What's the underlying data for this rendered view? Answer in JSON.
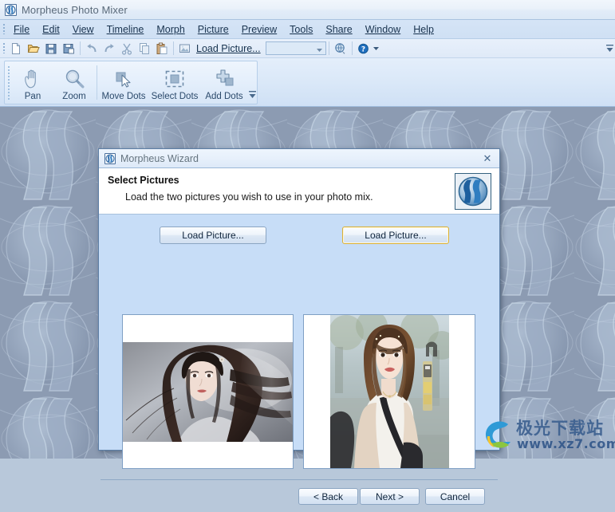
{
  "window": {
    "title": "Morpheus Photo Mixer",
    "icon": "app-icon"
  },
  "menubar": {
    "items": [
      {
        "label": "File"
      },
      {
        "label": "Edit"
      },
      {
        "label": "View"
      },
      {
        "label": "Timeline"
      },
      {
        "label": "Morph"
      },
      {
        "label": "Picture"
      },
      {
        "label": "Preview"
      },
      {
        "label": "Tools"
      },
      {
        "label": "Share"
      },
      {
        "label": "Window"
      },
      {
        "label": "Help"
      }
    ]
  },
  "toolbar_small": {
    "buttons": [
      {
        "name": "new-icon"
      },
      {
        "name": "open-icon"
      },
      {
        "name": "save-icon"
      },
      {
        "name": "save-as-icon"
      },
      {
        "name": "undo-icon"
      },
      {
        "name": "redo-icon"
      },
      {
        "name": "cut-icon"
      },
      {
        "name": "copy-icon"
      },
      {
        "name": "paste-icon"
      }
    ],
    "load_picture_label": "Load Picture...",
    "combo_value": "",
    "globe_icon": "publish-icon",
    "help_icon": "help-icon",
    "overflow_icon": "toolbar-overflow-icon"
  },
  "toolbar_big": {
    "tools": [
      {
        "label": "Pan",
        "icon": "hand-icon"
      },
      {
        "label": "Zoom",
        "icon": "magnifier-icon"
      },
      {
        "label": "Move Dots",
        "icon": "move-dots-icon"
      },
      {
        "label": "Select Dots",
        "icon": "select-dots-icon"
      },
      {
        "label": "Add Dots",
        "icon": "add-dots-icon"
      }
    ]
  },
  "dialog": {
    "title": "Morpheus Wizard",
    "close_label": "✕",
    "header": {
      "title": "Select Pictures",
      "subtitle": "Load the two pictures you wish to use in your photo mix."
    },
    "load_left_label": "Load Picture...",
    "load_right_label": "Load Picture...",
    "previews": [
      {
        "name": "preview-left",
        "orientation": "landscape",
        "description": "Portrait photo of a woman with long dark flowing hair on grey background"
      },
      {
        "name": "preview-right",
        "orientation": "portrait",
        "description": "Photo of a woman in a beige cardigan on a city street"
      }
    ],
    "footer": {
      "back_label": "< Back",
      "next_label": "Next >",
      "cancel_label": "Cancel"
    }
  },
  "watermark": {
    "line1": "极光下载站",
    "line2": "www.xz7.com"
  },
  "colors": {
    "accent": "#2f6fb0",
    "dialog_bg": "#c7ddf7",
    "menu_bg": "#d5e4f6",
    "focus_border": "#d8b03a"
  }
}
